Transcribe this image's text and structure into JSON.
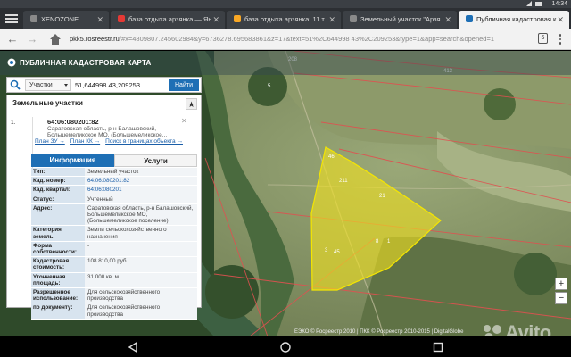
{
  "status": {
    "clock": "14:34"
  },
  "tabs": [
    {
      "label": "XENOZONE",
      "fav_color": "#8a8a8a"
    },
    {
      "label": "база отдыха арзянка — Ян",
      "fav_color": "#e53935"
    },
    {
      "label": "база отдыха арзянка: 11 т",
      "fav_color": "#f9a825"
    },
    {
      "label": "Земельный участок \"Арзя",
      "fav_color": "#8a8a8a"
    },
    {
      "label": "Публичная кадастровая к",
      "fav_color": "#1e6fb5"
    }
  ],
  "address": {
    "host": "pkk5.rosreestr.ru",
    "path": "/#x=4809807.245602984&y=6736278.695683861&z=17&text=51%2C644998 43%2C209253&type=1&app=search&opened=1",
    "tab_count": "5"
  },
  "app": {
    "title": "ПУБЛИЧНАЯ КАДАСТРОВАЯ КАРТА"
  },
  "search": {
    "type_label": "Участки",
    "query": "51,644998 43,209253",
    "button": "Найти"
  },
  "panel": {
    "title": "Земельные участки",
    "index": "1.",
    "cad_number": "64:06:080201:82",
    "address": "Саратовская область, р-н Балашовский, Большемеликское МО, (Большемеликское...",
    "links": [
      "План ЗУ →",
      "План КК →",
      "Поиск в границах объекта →"
    ],
    "tab_info": "Информация",
    "tab_services": "Услуги",
    "rows": [
      {
        "k": "Тип:",
        "v": "Земельный участок",
        "link": false
      },
      {
        "k": "Кад. номер:",
        "v": "64:06:080201:82",
        "link": true
      },
      {
        "k": "Кад. квартал:",
        "v": "64:06:080201",
        "link": true
      },
      {
        "k": "Статус:",
        "v": "Учтенный",
        "link": false
      },
      {
        "k": "Адрес:",
        "v": "Саратовская область, р-н Балашовский, Большемеликское МО, (Большемеликское поселение)",
        "link": false
      },
      {
        "k": "Категория земель:",
        "v": "Земли сельскохозяйственного назначения",
        "link": false
      },
      {
        "k": "Форма собственности:",
        "v": "-",
        "link": false
      },
      {
        "k": "Кадастровая стоимость:",
        "v": "108 810,00 руб.",
        "link": false
      },
      {
        "k": "Уточненная площадь:",
        "v": "31 000 кв. м",
        "link": false
      },
      {
        "k": "Разрешенное использование:",
        "v": "Для сельскохозяйственного производства",
        "link": false
      },
      {
        "k": "по документу:",
        "v": "Для сельскохозяйственного производства",
        "link": false
      }
    ]
  },
  "map": {
    "labels": [
      "208",
      "413",
      "5",
      "46",
      "211",
      "21",
      "3",
      "45",
      "8",
      "1"
    ],
    "attribution": "ЕЭКО © Росреестр 2010 | ПКК © Росреестр 2010-2015 | DigitalGlobe"
  },
  "watermark": "Avito",
  "colors": {
    "accent": "#1e6fb5",
    "plot_fill": "#f0e020"
  }
}
